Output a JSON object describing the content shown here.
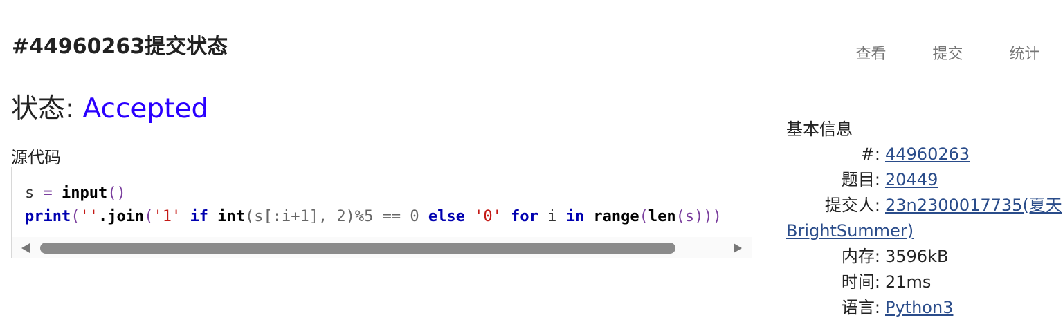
{
  "header": {
    "title": "#44960263提交状态",
    "nav": [
      {
        "label": "查看"
      },
      {
        "label": "提交"
      },
      {
        "label": "统计"
      }
    ]
  },
  "status": {
    "label": "状态:",
    "value": "Accepted"
  },
  "source": {
    "label": "源代码",
    "line1": {
      "var": "s",
      "eq": " = ",
      "func": "input",
      "parens": "()"
    },
    "line2": {
      "print": "print",
      "open": "(",
      "empty_str": "''",
      "join": ".join",
      "open2": "(",
      "one_str": "'1'",
      "sp1": " ",
      "if_kw": "if",
      "sp2": " ",
      "int_fn": "int",
      "args": "(s[:i+1], 2)%5 == ",
      "zero": "0",
      "sp3": " ",
      "else_kw": "else",
      "sp4": " ",
      "zero_str": "'0'",
      "sp5": " ",
      "for_kw": "for",
      "mid": " i ",
      "in_kw": "in",
      "sp6": " ",
      "range_fn": "range",
      "open3": "(",
      "len_fn": "len",
      "tail": "(s)))"
    }
  },
  "info": {
    "title": "基本信息",
    "rows": [
      {
        "label": "#:",
        "value": "44960263"
      },
      {
        "label": "题目:",
        "value": "20449"
      },
      {
        "label": "提交人:",
        "value": "23n2300017735(夏天",
        "value_cont": "BrightSummer)"
      },
      {
        "label": "内存:",
        "value": "3596kB"
      },
      {
        "label": "时间:",
        "value": "21ms"
      },
      {
        "label": "语言:",
        "value": "Python3"
      }
    ]
  },
  "colors": {
    "accepted": "#2a00ff",
    "link": "#2a4c8a",
    "keyword": "#0000b0",
    "string": "#c41a16"
  }
}
